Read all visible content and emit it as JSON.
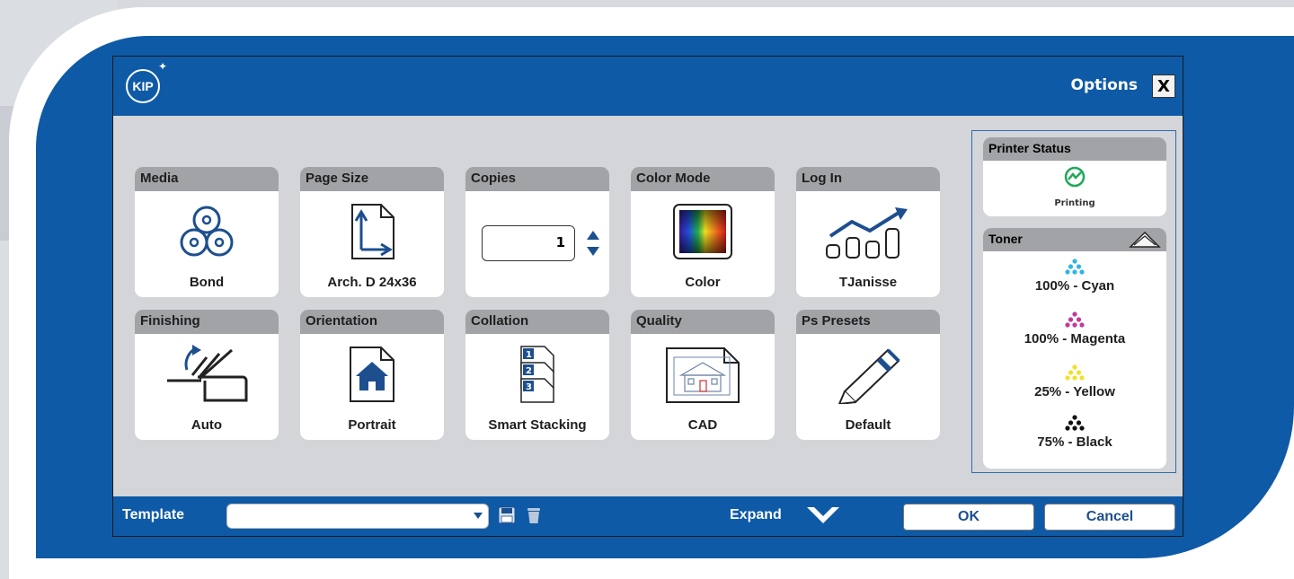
{
  "window": {
    "brand": "KIP",
    "options_label": "Options",
    "close_label": "X"
  },
  "tiles": [
    {
      "label": "Media",
      "value": "Bond",
      "icon": "media-rolls-icon"
    },
    {
      "label": "Page Size",
      "value": "Arch. D 24x36",
      "icon": "page-size-icon"
    },
    {
      "label": "Copies",
      "value": "1",
      "icon": "spinner-icon"
    },
    {
      "label": "Color Mode",
      "value": "Color",
      "icon": "color-gradient-icon"
    },
    {
      "label": "Log In",
      "value": "TJanisse",
      "icon": "log-chart-icon"
    },
    {
      "label": "Finishing",
      "value": "Auto",
      "icon": "finishing-icon"
    },
    {
      "label": "Orientation",
      "value": "Portrait",
      "icon": "portrait-house-icon"
    },
    {
      "label": "Collation",
      "value": "Smart Stacking",
      "icon": "collation-icon"
    },
    {
      "label": "Quality",
      "value": "CAD",
      "icon": "cad-drawing-icon"
    },
    {
      "label": "Ps Presets",
      "value": "Default",
      "icon": "pen-icon"
    }
  ],
  "printer_status": {
    "title": "Printer Status",
    "state": "Printing",
    "color": "#1fa85a"
  },
  "toner": {
    "title": "Toner",
    "items": [
      {
        "label": "100% - Cyan",
        "level": 100,
        "color": "#2fb4e8"
      },
      {
        "label": "100% - Magenta",
        "level": 100,
        "color": "#c2399a"
      },
      {
        "label": "25% - Yellow",
        "level": 25,
        "color": "#f2e12a"
      },
      {
        "label": "75% - Black",
        "level": 75,
        "color": "#111111"
      }
    ]
  },
  "footer": {
    "template_label": "Template",
    "template_value": "",
    "expand_label": "Expand",
    "ok_label": "OK",
    "cancel_label": "Cancel"
  },
  "colors": {
    "frame_blue": "#0e5aa6",
    "header_gray": "#a2a3a7",
    "panel_bg": "#d4d5d9",
    "icon_blue": "#1d4f8f"
  }
}
